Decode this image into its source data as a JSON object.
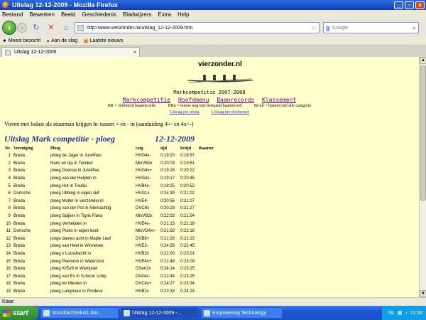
{
  "window": {
    "title": "Uitslag 12-12-2009 - Mozilla Firefox"
  },
  "menu": [
    "Bestand",
    "Bewerken",
    "Beeld",
    "Geschiedenis",
    "Bladwijzers",
    "Extra",
    "Help"
  ],
  "nav": {
    "url": "http://www.vierzonder.nl/uitslag_12-12-2009.htm",
    "search_placeholder": "Google"
  },
  "bookmarks": [
    "Meest bezocht",
    "Aan de slag",
    "Laatste nieuws"
  ],
  "tab": {
    "label": "Uitslag 12-12-2009"
  },
  "page": {
    "brand": "vierzonder.nl",
    "subtitle": "Markcompetitie  2007-2008",
    "links": [
      "Markcompetitie",
      "Hoofdmenu",
      "Baanrecords",
      "Klassement"
    ],
    "legend": [
      "BR = verbeterd baanrecords",
      "BRn = nieuw nog niet bestaand baanrecord",
      "Br-all = baanrecord alle categorie"
    ],
    "links2": [
      "Uitslag per ploeg",
      "Uitslag per deelnemer"
    ],
    "notice": "Vieren met balast als stuurman krijgen hc tussen + en  - in (aanduiding 4+-  en 4x+-)",
    "heading": "Uitslag Mark competitie - ploeg",
    "heading_date": "12-12-2009",
    "columns": [
      "Nr.",
      "Vereniging",
      "Ploeg",
      "catg",
      "tijd",
      "hctijd",
      "Baanrec"
    ],
    "rows": [
      [
        "1",
        "Breda",
        "ploeg de Jager in Just4four",
        "HVG4x-",
        "0:19:20",
        "0:18:57",
        ""
      ],
      [
        "2",
        "Breda",
        "Hans en Ilja in Twinkel",
        "MixVB2x",
        "0:20:03",
        "0:19:51",
        ""
      ],
      [
        "3",
        "Breda",
        "ploeg Doense in Just4five",
        "HVG4x+",
        "0:19:28",
        "0:20:22",
        ""
      ],
      [
        "4",
        "Breda",
        "ploeg van der Heijden in",
        "HVG4x-",
        "0:19:17",
        "0:20:45",
        ""
      ],
      [
        "5",
        "Breda",
        "ploeg Hut in Tredici",
        "HVB4x-",
        "0:18:25",
        "0:20:52",
        ""
      ],
      [
        "6",
        "Dortsche",
        "ploeg Ubbing in eigen skif",
        "HVG1x",
        "0:24:39",
        "0:21:02",
        ""
      ],
      [
        "7",
        "Breda",
        "ploeg Muller in vierzonder.nl",
        "HVE4-",
        "0:20:56",
        "0:21:07",
        ""
      ],
      [
        "8",
        "Breda",
        "ploeg van der Pol in Allemachtig",
        "DVC8x",
        "0:20:29",
        "0:21:27",
        ""
      ],
      [
        "9",
        "Breda",
        "ploeg Spijker in Tigris Flava",
        "MixVB2x",
        "0:22:03",
        "0:21:54",
        ""
      ],
      [
        "10",
        "Breda",
        "ploeg Verheijden in",
        "HVE4x-",
        "0:21:13",
        "0:22:18",
        ""
      ],
      [
        "11",
        "Dortsche",
        "ploeg Poots in eigen boot",
        "MixVD4x+-",
        "0:21:59",
        "0:22:18",
        ""
      ],
      [
        "12",
        "Breda",
        "jonge dames acht in Maple Leaf",
        "DVB8+",
        "0:21:28",
        "0:22:23",
        ""
      ],
      [
        "13",
        "Breda",
        "ploeg van Heel in Winnetwo",
        "HVE2-",
        "0:24:28",
        "0:22:45",
        ""
      ],
      [
        "14",
        "Breda",
        "ploeg v Loosdrecht in",
        "HVB2x",
        "0:22:00",
        "0:23:01",
        ""
      ],
      [
        "15",
        "Breda",
        "ploeg Peetoom in Waterzooi",
        "HVE4x+",
        "0:21:49",
        "0:23:09",
        ""
      ],
      [
        "16",
        "Breda",
        "ploeg KrEeft in Wampoei",
        "DSen2x",
        "0:24:14",
        "0:23:15",
        ""
      ],
      [
        "17",
        "Breda",
        "ploeg van Es in Schoon schip",
        "DVA4x-",
        "0:22:44",
        "0:23:25",
        ""
      ],
      [
        "18",
        "Breda",
        "ploeg ter Meulen in",
        "DVC4x+",
        "0:24:27",
        "0:23:34",
        ""
      ],
      [
        "19",
        "Breda",
        "ploeg Langmuur in Prodeux",
        "HVB2x",
        "0:23:33",
        "0:24:24",
        ""
      ]
    ]
  },
  "status": "Klaar",
  "taskbar": {
    "start": "start",
    "items": [
      "Voordrachttekst1.doc...",
      "Uitslag 12-12-2009 -...",
      "Empowering Technology"
    ],
    "lang": "NL",
    "clock": "11:32"
  }
}
